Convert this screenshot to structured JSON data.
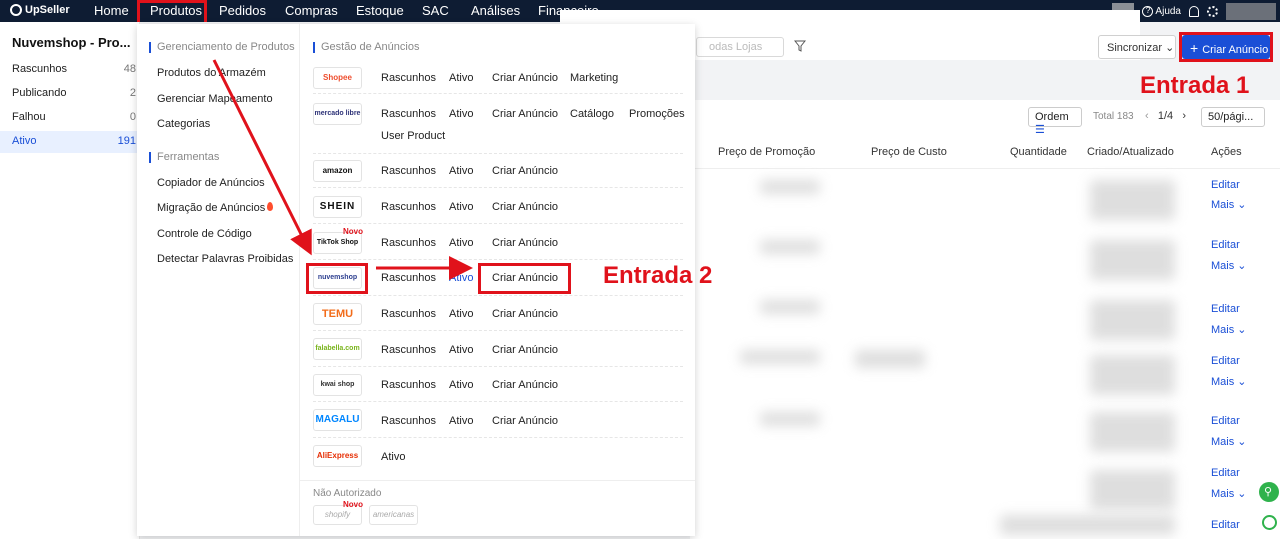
{
  "app": {
    "brand": "UpSeller"
  },
  "topnav": {
    "items": [
      {
        "label": "Home"
      },
      {
        "label": "Produtos"
      },
      {
        "label": "Pedidos"
      },
      {
        "label": "Compras"
      },
      {
        "label": "Estoque"
      },
      {
        "label": "SAC"
      },
      {
        "label": "Análises"
      },
      {
        "label": "Financeiro"
      }
    ],
    "help_label": "Ajuda"
  },
  "sidebar": {
    "title": "Nuvemshop - Pro...",
    "items": [
      {
        "label": "Rascunhos",
        "count": "48"
      },
      {
        "label": "Publicando",
        "count": "2"
      },
      {
        "label": "Falhou",
        "count": "0"
      },
      {
        "label": "Ativo",
        "count": "191"
      }
    ]
  },
  "toolbar": {
    "store_filter_placeholder": "odas Lojas",
    "sync_label": "Sincronizar",
    "create_label": "Criar Anúncio",
    "order_label": "Ordem",
    "total_label": "Total 183",
    "page_label": "1/4",
    "per_page_label": "50/pági..."
  },
  "table": {
    "columns": [
      "Preço de Promoção",
      "Preço de Custo",
      "Quantidade",
      "Criado/Atualizado",
      "Ações"
    ],
    "row_actions": {
      "edit": "Editar",
      "more": "Mais"
    }
  },
  "annotations": {
    "entrada1": "Entrada 1",
    "entrada2": "Entrada 2"
  },
  "menu": {
    "left": {
      "section1": "Gerenciamento de Produtos",
      "section1_items": [
        "Produtos do Armazém",
        "Gerenciar Mapeamento",
        "Categorias"
      ],
      "section2": "Ferramentas",
      "section2_items": [
        "Copiador de Anúncios",
        "Migração de Anúncios",
        "Controle de Código",
        "Detectar Palavras Proibidas"
      ]
    },
    "right": {
      "heading": "Gestão de Anúncios",
      "platforms": [
        {
          "logo": "Shopee",
          "links": [
            "Rascunhos",
            "Ativo",
            "Criar Anúncio",
            "Marketing"
          ]
        },
        {
          "logo": "mercado libre",
          "links": [
            "Rascunhos",
            "Ativo",
            "Criar Anúncio",
            "Catálogo",
            "Promoções",
            "User Product"
          ]
        },
        {
          "logo": "amazon",
          "links": [
            "Rascunhos",
            "Ativo",
            "Criar Anúncio"
          ]
        },
        {
          "logo": "SHEIN",
          "links": [
            "Rascunhos",
            "Ativo",
            "Criar Anúncio"
          ]
        },
        {
          "logo": "TikTok Shop",
          "badge": "Novo",
          "links": [
            "Rascunhos",
            "Ativo",
            "Criar Anúncio"
          ]
        },
        {
          "logo": "nuvemshop",
          "links": [
            "Rascunhos",
            "Ativo",
            "Criar Anúncio"
          ]
        },
        {
          "logo": "TEMU",
          "links": [
            "Rascunhos",
            "Ativo",
            "Criar Anúncio"
          ]
        },
        {
          "logo": "falabella.com",
          "links": [
            "Rascunhos",
            "Ativo",
            "Criar Anúncio"
          ]
        },
        {
          "logo": "kwai shop",
          "links": [
            "Rascunhos",
            "Ativo",
            "Criar Anúncio"
          ]
        },
        {
          "logo": "magalu",
          "links": [
            "Rascunhos",
            "Ativo",
            "Criar Anúncio"
          ]
        },
        {
          "logo": "AliExpress",
          "links": [
            "Ativo"
          ]
        }
      ],
      "not_authorized": "Não Autorizado",
      "na_logos": [
        {
          "logo": "shopify",
          "badge": "Novo"
        },
        {
          "logo": "americanas"
        }
      ]
    }
  },
  "colors": {
    "accent": "#1a4fd6",
    "topbar": "#0e1c33",
    "highlight": "#e0121b"
  }
}
